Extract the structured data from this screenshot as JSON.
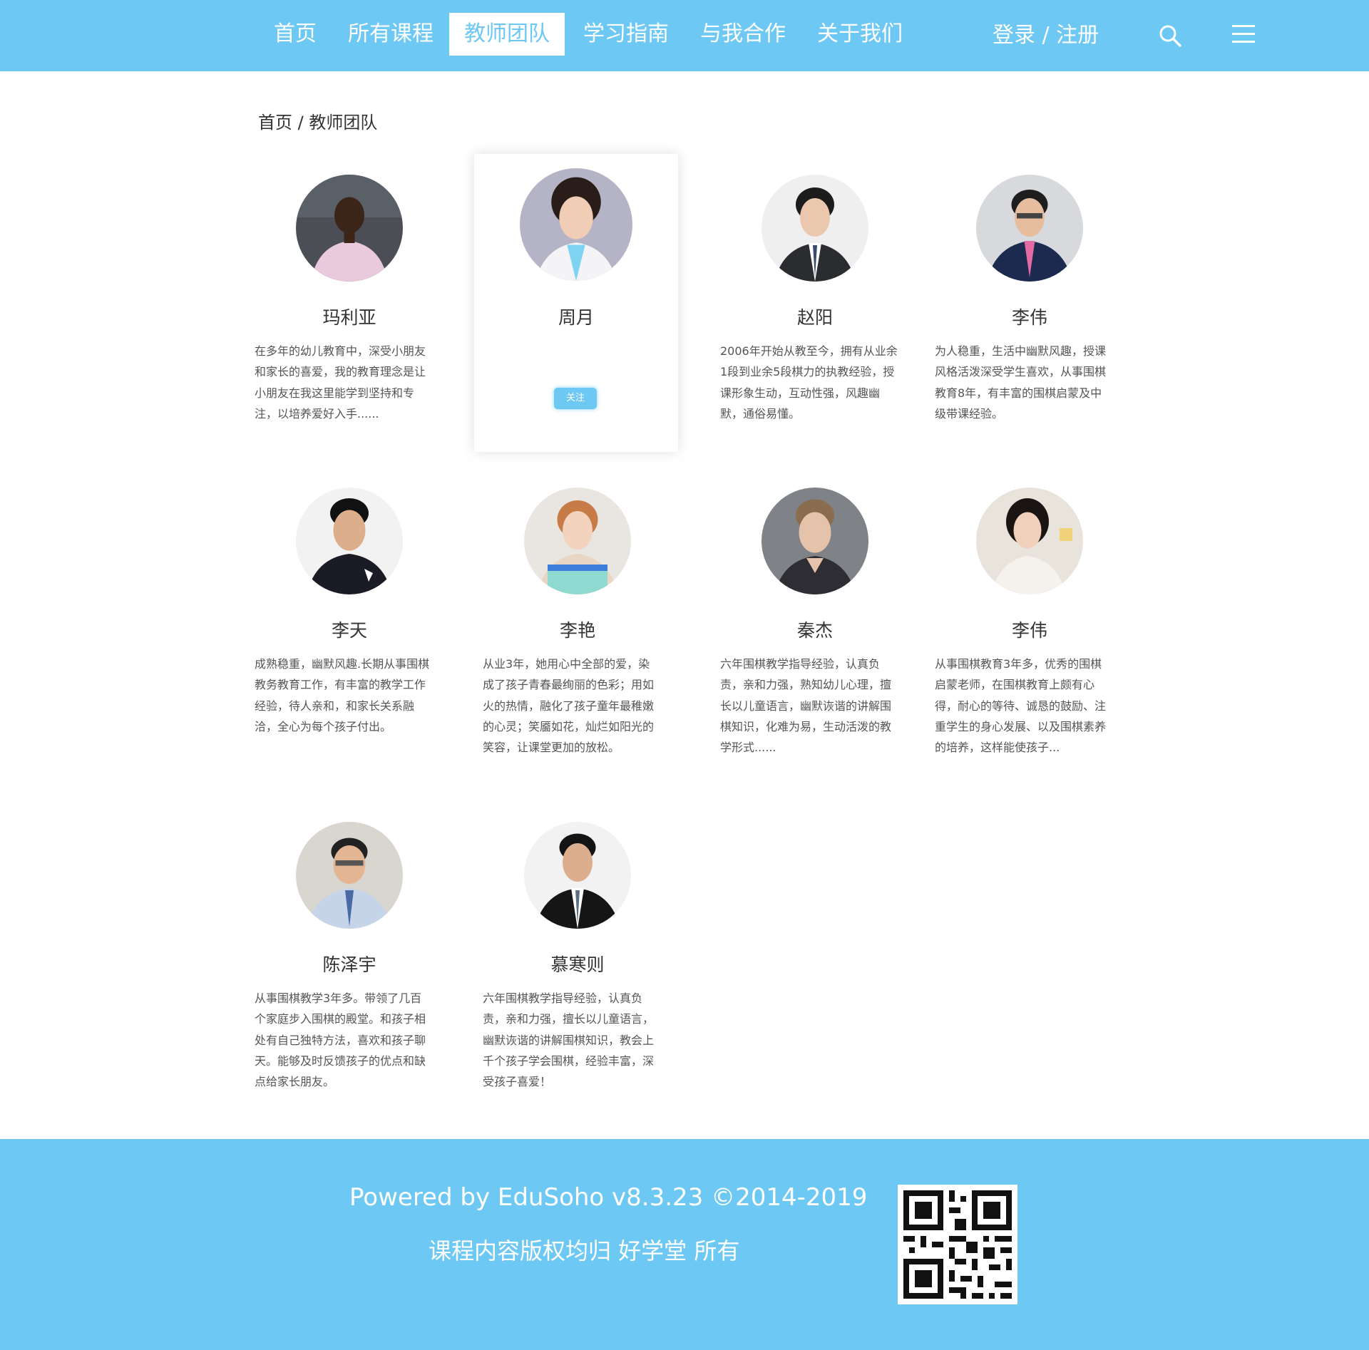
{
  "nav": {
    "items": [
      "首页",
      "所有课程",
      "教师团队",
      "学习指南",
      "与我合作",
      "关于我们"
    ],
    "active_index": 2,
    "login_label": "登录 / 注册",
    "search_icon": "search-icon",
    "menu_icon": "hamburger-menu-icon"
  },
  "breadcrumb": "首页 / 教师团队",
  "teachers": [
    {
      "name": "玛利亚",
      "desc": "在多年的幼儿教育中，深受小朋友和家长的喜爱，我的教育理念是让小朋友在我这里能学到坚持和专注，以培养爱好入手......"
    },
    {
      "name": "周月",
      "desc": "",
      "follow_label": "关注"
    },
    {
      "name": "赵阳",
      "desc": "2006年开始从教至今，拥有从业余1段到业余5段棋力的执教经验，授课形象生动，互动性强，风趣幽默，通俗易懂。"
    },
    {
      "name": "李伟",
      "desc": "为人稳重，生活中幽默风趣，授课风格活泼深受学生喜欢，从事围棋教育8年，有丰富的围棋启蒙及中级带课经验。"
    },
    {
      "name": "李天",
      "desc": "成熟稳重，幽默风趣.长期从事围棋教务教育工作，有丰富的教学工作经验，待人亲和，和家长关系融洽，全心为每个孩子付出。"
    },
    {
      "name": "李艳",
      "desc": "从业3年，她用心中全部的爱，染成了孩子青春最绚丽的色彩；用如火的热情，融化了孩子童年最稚嫩的心灵；笑靥如花，灿烂如阳光的笑容，让课堂更加的放松。"
    },
    {
      "name": "秦杰",
      "desc": "六年围棋教学指导经验，认真负责，亲和力强，熟知幼儿心理，擅长以儿童语言，幽默诙谐的讲解围棋知识，化难为易，生动活泼的教学形式......"
    },
    {
      "name": "李伟",
      "desc": "从事围棋教育3年多，优秀的围棋启蒙老师，在围棋教育上颇有心得，耐心的等待、诚恳的鼓励、注重学生的身心发展、以及围棋素养的培养，这样能使孩子..."
    },
    {
      "name": "陈泽宇",
      "desc": "从事围棋教学3年多。带领了几百个家庭步入围棋的殿堂。和孩子相处有自己独特方法，喜欢和孩子聊天。能够及时反馈孩子的优点和缺点给家长朋友。"
    },
    {
      "name": "慕寒则",
      "desc": "六年围棋教学指导经验，认真负责，亲和力强，擅长以儿童语言，幽默诙谐的讲解围棋知识，教会上千个孩子学会围棋，经验丰富，深受孩子喜爱！"
    }
  ],
  "footer": {
    "powered": "Powered by EduSoho v8.3.23 ©2014-2019",
    "copyright": "课程内容版权均归 好学堂 所有"
  },
  "colors": {
    "primary": "#6ec8f4",
    "text": "#333333"
  }
}
